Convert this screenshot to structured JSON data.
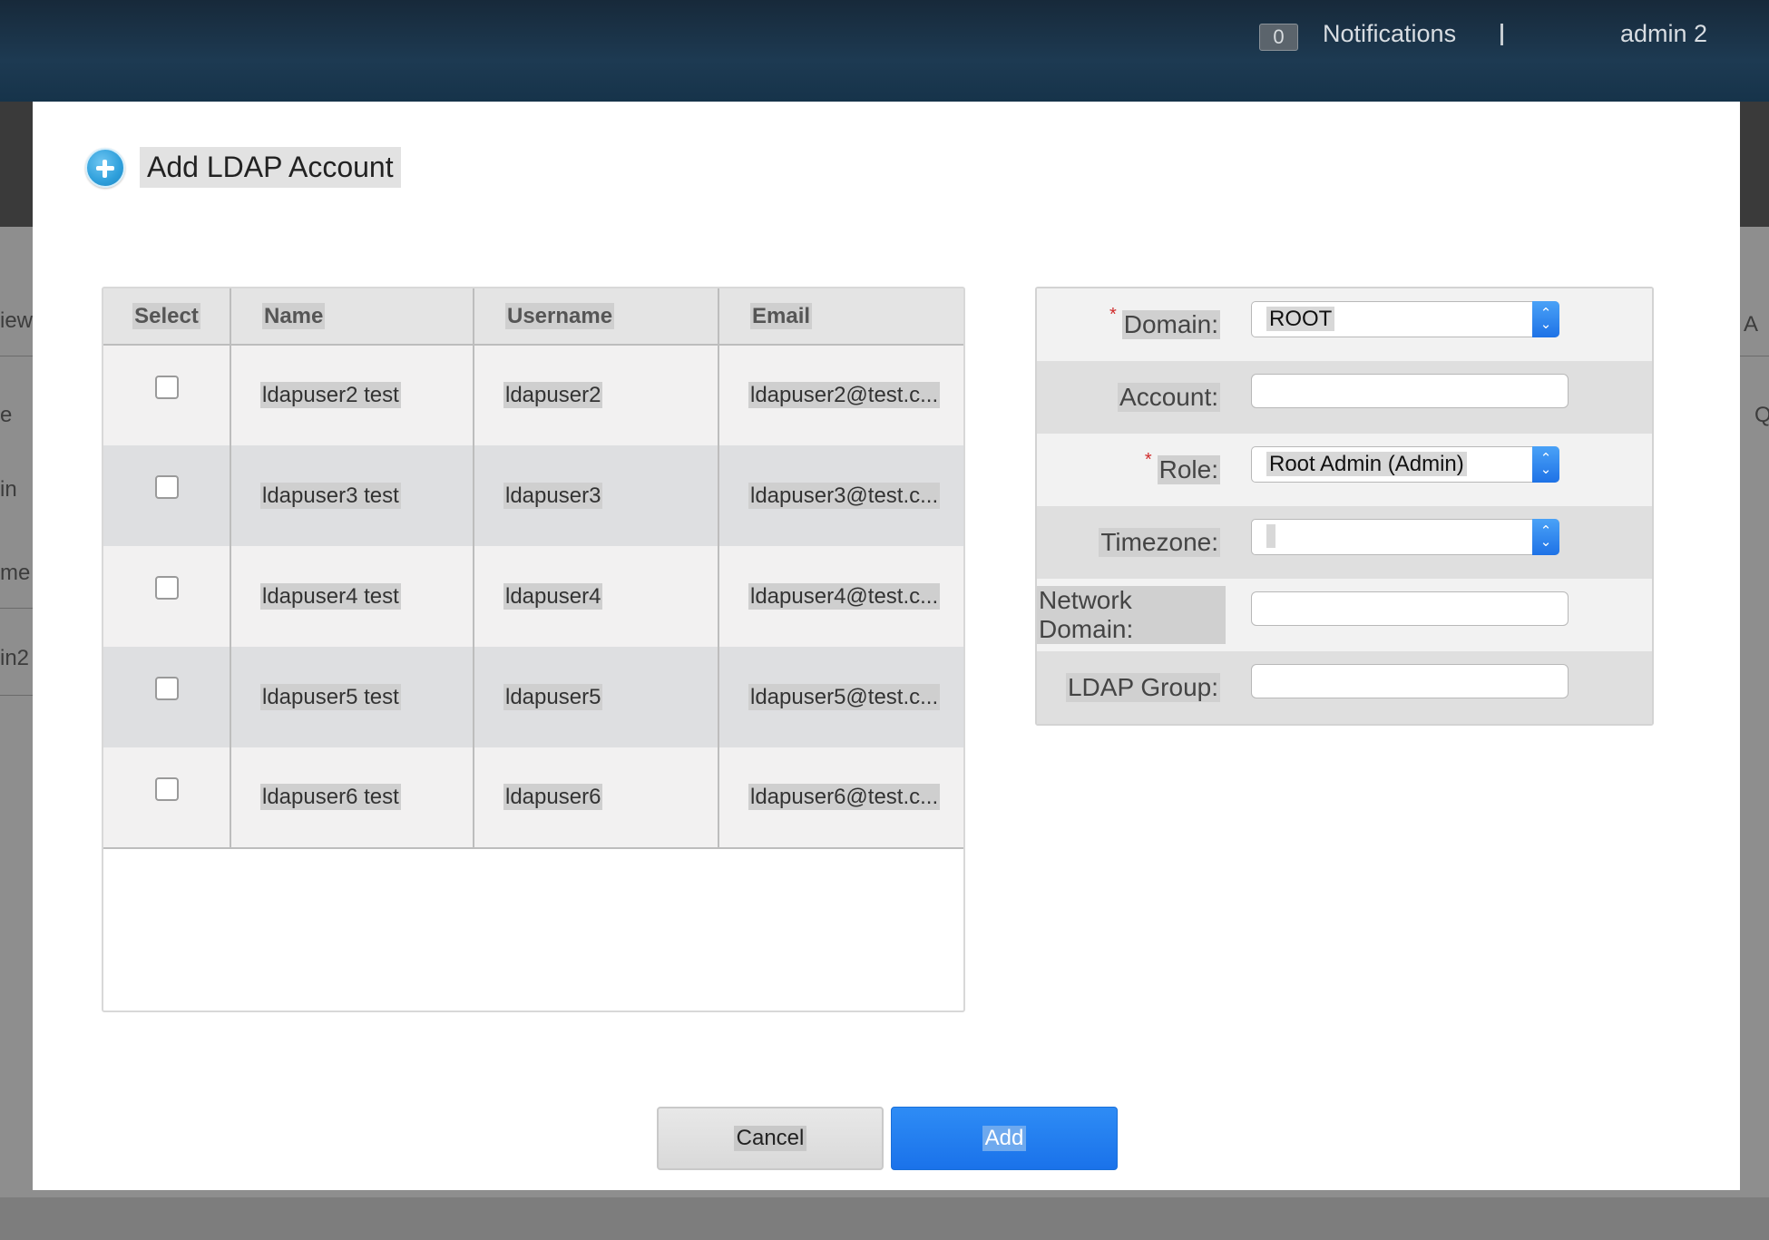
{
  "topbar": {
    "notifications_count": "0",
    "notifications_label": "Notifications",
    "separator": "|",
    "username": "admin 2"
  },
  "background": {
    "left_fragments": [
      "iew",
      "e",
      "in",
      "me",
      "in2"
    ],
    "right_fragments": [
      "A",
      "Q"
    ]
  },
  "dialog": {
    "title": "Add LDAP Account",
    "table": {
      "columns": [
        "Select",
        "Name",
        "Username",
        "Email"
      ],
      "rows": [
        {
          "name": "ldapuser2 test",
          "username": "ldapuser2",
          "email": "ldapuser2@test.c...",
          "selected": false
        },
        {
          "name": "ldapuser3 test",
          "username": "ldapuser3",
          "email": "ldapuser3@test.c...",
          "selected": false
        },
        {
          "name": "ldapuser4 test",
          "username": "ldapuser4",
          "email": "ldapuser4@test.c...",
          "selected": false
        },
        {
          "name": "ldapuser5 test",
          "username": "ldapuser5",
          "email": "ldapuser5@test.c...",
          "selected": false
        },
        {
          "name": "ldapuser6 test",
          "username": "ldapuser6",
          "email": "ldapuser6@test.c...",
          "selected": false
        }
      ]
    },
    "form": {
      "domain": {
        "label": "Domain:",
        "required": true,
        "value": "ROOT"
      },
      "account": {
        "label": "Account:",
        "required": false,
        "value": ""
      },
      "role": {
        "label": "Role:",
        "required": true,
        "value": "Root Admin (Admin)"
      },
      "timezone": {
        "label": "Timezone:",
        "required": false,
        "value": ""
      },
      "network_domain": {
        "label": "Network Domain:",
        "required": false,
        "value": ""
      },
      "ldap_group": {
        "label": "LDAP Group:",
        "required": false,
        "value": ""
      },
      "required_marker": "*"
    },
    "buttons": {
      "cancel": "Cancel",
      "add": "Add"
    }
  },
  "colors": {
    "accent": "#1a72ea",
    "required": "#d02b2b",
    "topbar": "#1d3a52"
  },
  "icons": {
    "title_icon": "add-circle-icon",
    "select_arrow": "updown-chevron-icon"
  }
}
